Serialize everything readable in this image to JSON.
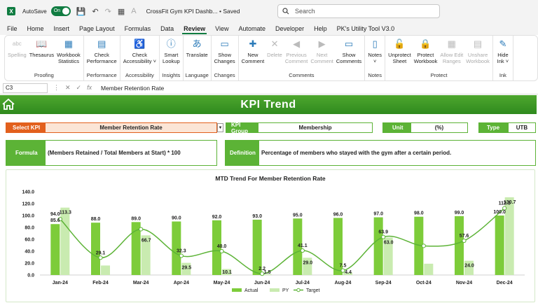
{
  "titlebar": {
    "autosave_label": "AutoSave",
    "toggle_label": "On",
    "doc_title": "CrossFit Gym KPI Dashb... • Saved",
    "search_placeholder": "Search"
  },
  "menu": [
    "File",
    "Home",
    "Insert",
    "Page Layout",
    "Formulas",
    "Data",
    "Review",
    "View",
    "Automate",
    "Developer",
    "Help",
    "PK's Utility Tool V3.0"
  ],
  "menu_active": "Review",
  "ribbon": {
    "groups": [
      {
        "label": "Proofing",
        "buttons": [
          {
            "text": "Spelling",
            "icon": "abc-check-icon",
            "disabled": true
          },
          {
            "text": "Thesaurus",
            "icon": "book-icon"
          },
          {
            "text": "Workbook\nStatistics",
            "icon": "statistics-icon"
          }
        ]
      },
      {
        "label": "Performance",
        "buttons": [
          {
            "text": "Check\nPerformance",
            "icon": "performance-icon"
          }
        ]
      },
      {
        "label": "Accessibility",
        "buttons": [
          {
            "text": "Check\nAccessibility ˅",
            "icon": "accessibility-icon"
          }
        ]
      },
      {
        "label": "Insights",
        "buttons": [
          {
            "text": "Smart\nLookup",
            "icon": "info-icon"
          }
        ]
      },
      {
        "label": "Language",
        "buttons": [
          {
            "text": "Translate",
            "icon": "translate-icon"
          }
        ]
      },
      {
        "label": "Changes",
        "buttons": [
          {
            "text": "Show\nChanges",
            "icon": "changes-icon"
          }
        ]
      },
      {
        "label": "Comments",
        "buttons": [
          {
            "text": "New\nComment",
            "icon": "new-comment-icon"
          },
          {
            "text": "Delete",
            "icon": "delete-comment-icon",
            "disabled": true
          },
          {
            "text": "Previous\nComment",
            "icon": "previous-comment-icon",
            "disabled": true
          },
          {
            "text": "Next\nComment",
            "icon": "next-comment-icon",
            "disabled": true
          },
          {
            "text": "Show\nComments",
            "icon": "show-comments-icon"
          }
        ]
      },
      {
        "label": "Notes",
        "buttons": [
          {
            "text": "Notes\n˅",
            "icon": "notes-icon"
          }
        ]
      },
      {
        "label": "Protect",
        "buttons": [
          {
            "text": "Unprotect\nSheet",
            "icon": "unprotect-sheet-icon"
          },
          {
            "text": "Protect\nWorkbook",
            "icon": "protect-workbook-icon"
          },
          {
            "text": "Allow Edit\nRanges",
            "icon": "allow-edit-icon",
            "disabled": true
          },
          {
            "text": "Unshare\nWorkbook",
            "icon": "unshare-icon",
            "disabled": true
          }
        ]
      },
      {
        "label": "Ink",
        "buttons": [
          {
            "text": "Hide\nInk ˅",
            "icon": "ink-icon"
          }
        ]
      }
    ]
  },
  "formula_bar": {
    "name_box": "C3",
    "formula": "Member Retention Rate"
  },
  "dashboard": {
    "title": "KPI Trend",
    "select_kpi_label": "Select KPI",
    "select_kpi_value": "Member Retention Rate",
    "kpi_group_label": "KPI Group",
    "kpi_group_value": "Membership",
    "unit_label": "Unit",
    "unit_value": "(%)",
    "type_label": "Type",
    "type_value": "UTB",
    "formula_label": "Formula",
    "formula_value": "(Members Retained / Total Members at Start) * 100",
    "definition_label": "Definition",
    "definition_value": "Percentage of members who stayed with the gym after a certain period."
  },
  "colors": {
    "accent": "#5cb336",
    "orange": "#e2601d",
    "actual": "#7dcc3a",
    "py": "#c9ebb0",
    "target_line": "#5cb336"
  },
  "chart_data": {
    "type": "bar",
    "title": "MTD Trend For Member Retention Rate",
    "categories": [
      "Jan-24",
      "Feb-24",
      "Mar-24",
      "Apr-24",
      "May-24",
      "Jun-24",
      "Jul-24",
      "Aug-24",
      "Sep-24",
      "Oct-24",
      "Nov-24",
      "Dec-24"
    ],
    "series": [
      {
        "name": "Actual",
        "type": "bar",
        "values": [
          85.6,
          88.0,
          89.0,
          90.0,
          92.0,
          93.0,
          95.0,
          96.0,
          97.0,
          98.0,
          99.0,
          100.0
        ]
      },
      {
        "name": "PY",
        "type": "bar",
        "values": [
          113.3,
          16.0,
          66.7,
          20.5,
          10.1,
          1.5,
          29.0,
          4.4,
          63.0,
          19.0,
          24.0,
          130.7
        ]
      },
      {
        "name": "Target",
        "type": "line",
        "values": [
          94.0,
          29.1,
          77.0,
          32.3,
          40.0,
          2.2,
          41.1,
          7.5,
          63.9,
          49.0,
          57.6,
          112.3
        ]
      }
    ],
    "labels": {
      "Actual": [
        "85.6",
        "88.0",
        "89.0",
        "90.0",
        "92.0",
        "93.0",
        "95.0",
        "96.0",
        "97.0",
        "98.0",
        "99.0",
        "100.0"
      ],
      "PY": [
        "113.3",
        "",
        "66.7",
        "29.5",
        "10.1",
        "1.5",
        "29.0",
        "4.4",
        "63.0",
        "",
        "24.0",
        "130.7"
      ],
      "Target": [
        "94.0",
        "29.1",
        "",
        "32.3",
        "40.0",
        "2.2",
        "41.1",
        "7.5",
        "63.9",
        "",
        "57.6",
        "112.3"
      ]
    },
    "yticks": [
      "0.0",
      "20.0",
      "40.0",
      "60.0",
      "80.0",
      "100.0",
      "120.0",
      "140.0"
    ],
    "ylim": [
      0,
      140
    ],
    "legend_position": "bottom",
    "grid": false
  }
}
